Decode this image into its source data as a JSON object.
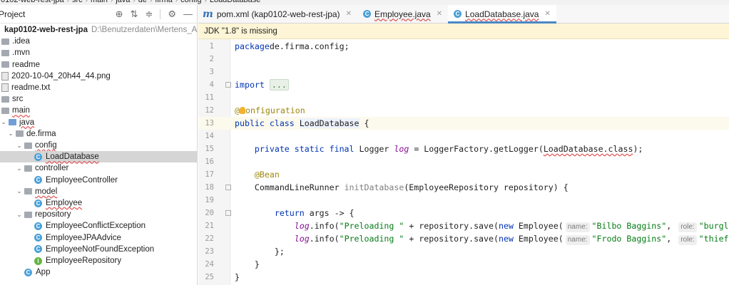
{
  "breadcrumb": [
    "0102-web-rest-jpa",
    "src",
    "main",
    "java",
    "de",
    "firma",
    "config",
    "LoadDatabase"
  ],
  "project_panel": {
    "title": "Project",
    "tools": [
      "target-icon",
      "collapse-icon",
      "expand-icon",
      "gear-icon",
      "minimize-icon"
    ],
    "tree": [
      {
        "label": "kap0102-web-rest-jpa",
        "path": "D:\\Benutzerdaten\\Mertens_Achim\\my-work",
        "indent": 0,
        "icon": "folder",
        "chevron": "",
        "bold": true
      },
      {
        "label": ".idea",
        "indent": 0,
        "icon": "folder",
        "chevron": ""
      },
      {
        "label": ".mvn",
        "indent": 0,
        "icon": "folder",
        "chevron": ""
      },
      {
        "label": "readme",
        "indent": 0,
        "icon": "folder",
        "chevron": ""
      },
      {
        "label": "2020-10-04_20h44_44.png",
        "indent": 0,
        "icon": "file",
        "chevron": ""
      },
      {
        "label": "readme.txt",
        "indent": 0,
        "icon": "file",
        "chevron": ""
      },
      {
        "label": "src",
        "indent": 0,
        "icon": "folder",
        "chevron": ""
      },
      {
        "label": "main",
        "indent": 0,
        "icon": "folder",
        "chevron": "",
        "wavy": true
      },
      {
        "label": "java",
        "indent": 1,
        "icon": "folder-blue",
        "chevron": "v",
        "wavy": true
      },
      {
        "label": "de.firma",
        "indent": 2,
        "icon": "folder",
        "chevron": "v"
      },
      {
        "label": "config",
        "indent": 3,
        "icon": "folder",
        "chevron": "v",
        "wavy": true
      },
      {
        "label": "LoadDatabase",
        "indent": 4,
        "icon": "class",
        "chevron": "",
        "selected": true,
        "wavy": true
      },
      {
        "label": "controller",
        "indent": 3,
        "icon": "folder",
        "chevron": "v"
      },
      {
        "label": "EmployeeController",
        "indent": 4,
        "icon": "class",
        "chevron": ""
      },
      {
        "label": "model",
        "indent": 3,
        "icon": "folder",
        "chevron": "v",
        "wavy": true
      },
      {
        "label": "Employee",
        "indent": 4,
        "icon": "class",
        "chevron": "",
        "wavy": true
      },
      {
        "label": "repository",
        "indent": 3,
        "icon": "folder",
        "chevron": "v"
      },
      {
        "label": "EmployeeConflictException",
        "indent": 4,
        "icon": "class",
        "chevron": ""
      },
      {
        "label": "EmployeeJPAAdvice",
        "indent": 4,
        "icon": "class",
        "chevron": ""
      },
      {
        "label": "EmployeeNotFoundException",
        "indent": 4,
        "icon": "class",
        "chevron": ""
      },
      {
        "label": "EmployeeRepository",
        "indent": 4,
        "icon": "interface",
        "chevron": ""
      },
      {
        "label": "App",
        "indent": 3,
        "icon": "class",
        "chevron": ""
      }
    ]
  },
  "tabs": [
    {
      "label": "pom.xml (kap0102-web-rest-jpa)",
      "icon": "m",
      "active": false
    },
    {
      "label": "Employee.java",
      "icon": "class",
      "active": false,
      "wavy": true
    },
    {
      "label": "LoadDatabase.java",
      "icon": "class",
      "active": true,
      "wavy": true
    }
  ],
  "notice": "JDK \"1.8\" is missing",
  "code": {
    "current_line": "13",
    "lines": [
      {
        "n": "1",
        "segs": [
          [
            "kw",
            "package"
          ],
          [
            "",
            "de.firma.config;"
          ]
        ]
      },
      {
        "n": "2",
        "segs": []
      },
      {
        "n": "3",
        "segs": []
      },
      {
        "n": "4",
        "segs": [
          [
            "kw",
            "import "
          ],
          [
            "folded",
            "..."
          ]
        ]
      },
      {
        "n": "11",
        "segs": []
      },
      {
        "n": "12",
        "segs": [
          [
            "ann",
            "@"
          ],
          [
            "bulb",
            ""
          ],
          [
            "ann",
            "onfiguration"
          ]
        ]
      },
      {
        "n": "13",
        "segs": [
          [
            "kw",
            "public class "
          ],
          [
            "cls",
            "LoadDatabase"
          ],
          [
            "",
            " {"
          ]
        ]
      },
      {
        "n": "14",
        "segs": []
      },
      {
        "n": "15",
        "segs": [
          [
            "",
            "    "
          ],
          [
            "kw",
            "private static final "
          ],
          [
            "",
            "Logger "
          ],
          [
            "fld",
            "log"
          ],
          [
            "",
            " = LoggerFactory.getLogger("
          ],
          [
            "wavy",
            "LoadDatabase.class"
          ],
          [
            "",
            ");"
          ]
        ]
      },
      {
        "n": "16",
        "segs": []
      },
      {
        "n": "17",
        "segs": [
          [
            "",
            "    "
          ],
          [
            "ann",
            "@Bean"
          ]
        ]
      },
      {
        "n": "18",
        "segs": [
          [
            "",
            "    CommandLineRunner "
          ],
          [
            "unused",
            "initDatabase"
          ],
          [
            "",
            "(EmployeeRepository repository) {"
          ]
        ]
      },
      {
        "n": "19",
        "segs": []
      },
      {
        "n": "20",
        "segs": [
          [
            "",
            "        "
          ],
          [
            "kw",
            "return "
          ],
          [
            "",
            "args -> {"
          ]
        ]
      },
      {
        "n": "21",
        "segs": [
          [
            "",
            "            "
          ],
          [
            "fld",
            "log"
          ],
          [
            "",
            ".info("
          ],
          [
            "str",
            "\"Preloading \""
          ],
          [
            "",
            " + repository.save("
          ],
          [
            "kw",
            "new "
          ],
          [
            "",
            "Employee("
          ],
          [
            "hint",
            "name:"
          ],
          [
            "str",
            "\"Bilbo Baggins\""
          ],
          [
            "",
            ", "
          ],
          [
            "hint",
            "role:"
          ],
          [
            "str",
            "\"burglar\""
          ],
          [
            "",
            ")));"
          ]
        ]
      },
      {
        "n": "22",
        "segs": [
          [
            "",
            "            "
          ],
          [
            "fld",
            "log"
          ],
          [
            "",
            ".info("
          ],
          [
            "str",
            "\"Preloading \""
          ],
          [
            "",
            " + repository.save("
          ],
          [
            "kw",
            "new "
          ],
          [
            "",
            "Employee("
          ],
          [
            "hint",
            "name:"
          ],
          [
            "str",
            "\"Frodo Baggins\""
          ],
          [
            "",
            ", "
          ],
          [
            "hint",
            "role:"
          ],
          [
            "str",
            "\"thief\""
          ],
          [
            "",
            ")));"
          ]
        ]
      },
      {
        "n": "23",
        "segs": [
          [
            "",
            "        };"
          ]
        ]
      },
      {
        "n": "24",
        "segs": [
          [
            "",
            "    }"
          ]
        ]
      },
      {
        "n": "25",
        "segs": [
          [
            "",
            "}"
          ]
        ]
      }
    ]
  }
}
